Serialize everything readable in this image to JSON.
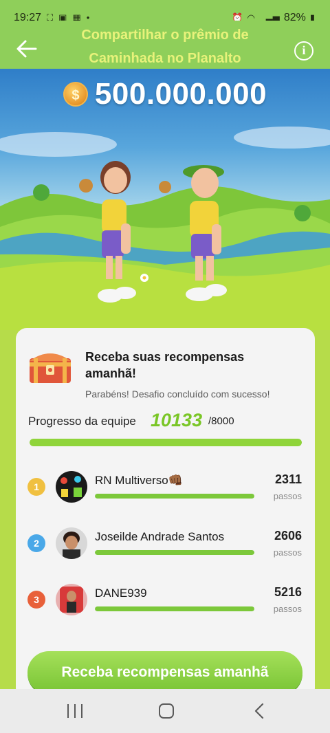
{
  "status_bar": {
    "time": "19:27",
    "battery": "82%"
  },
  "header": {
    "title": "Compartilhar o prêmio de Caminhada no Planalto",
    "back_icon": "arrow-left-icon",
    "info_icon": "info-icon"
  },
  "hero": {
    "prize_amount": "500.000.000",
    "coin_symbol": "$"
  },
  "card": {
    "title": "Receba suas recompensas amanhã!",
    "subtitle": "Parabéns! Desafio concluído com sucesso!",
    "progress_label": "Progresso da equipe",
    "progress_value": "10133",
    "progress_target": "/8000",
    "progress_fraction": 1.0,
    "members": [
      {
        "rank": "1",
        "name": "RN Multiverso👊🏾",
        "steps": "2311",
        "unit": "passos",
        "rank_color": "#f0c040",
        "progress": 1.0
      },
      {
        "rank": "2",
        "name": "Joseilde Andrade Santos",
        "steps": "2606",
        "unit": "passos",
        "rank_color": "#4aa8e8",
        "progress": 1.0
      },
      {
        "rank": "3",
        "name": "DANE939",
        "steps": "5216",
        "unit": "passos",
        "rank_color": "#e8603a",
        "progress": 1.0
      }
    ],
    "cta_label": "Receba recompensas amanhã"
  },
  "colors": {
    "accent_green": "#7ac626",
    "header_bg": "#8fcf5a",
    "title_yellow": "#e8f27a"
  }
}
